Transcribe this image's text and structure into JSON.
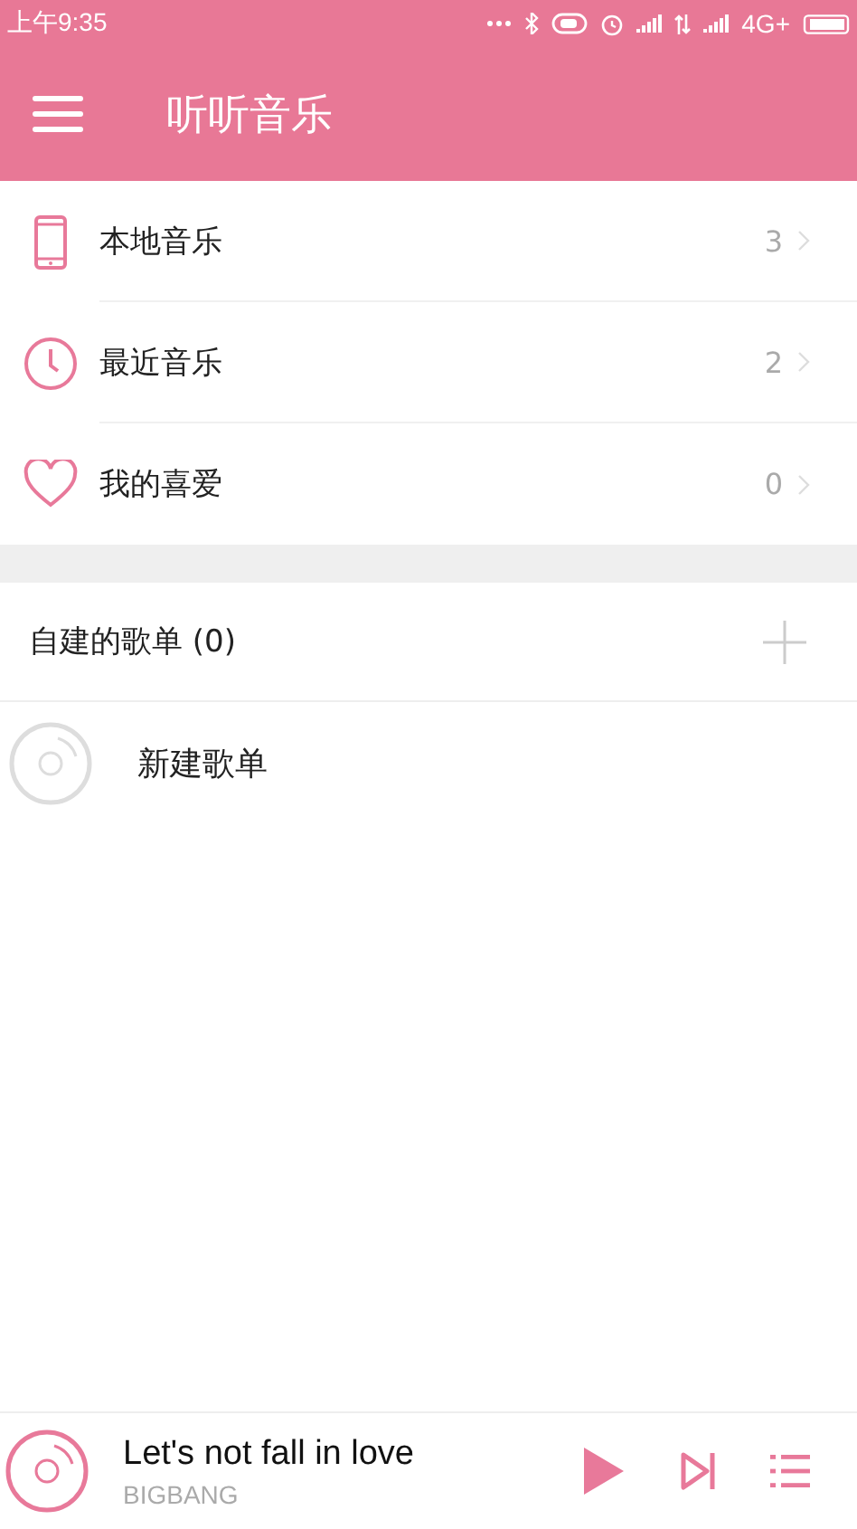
{
  "status_bar": {
    "time": "上午9:35",
    "network": "4G+"
  },
  "app_bar": {
    "title": "听听音乐"
  },
  "library": [
    {
      "kind": "phone",
      "label": "本地音乐",
      "count": "3"
    },
    {
      "kind": "clock",
      "label": "最近音乐",
      "count": "2"
    },
    {
      "kind": "heart",
      "label": "我的喜爱",
      "count": "0"
    }
  ],
  "playlists": {
    "header": "自建的歌单 (0)",
    "items": [
      {
        "label": "新建歌单"
      }
    ]
  },
  "player": {
    "title": "Let's not fall in love",
    "artist": "BIGBANG",
    "playing": false
  }
}
